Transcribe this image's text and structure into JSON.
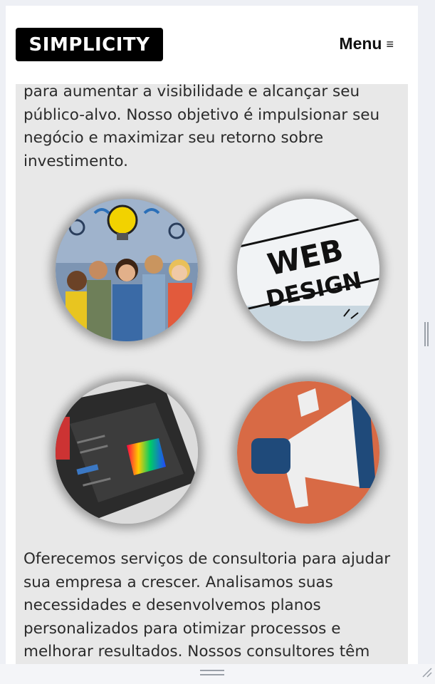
{
  "header": {
    "logo_text": "SIMPLICITY",
    "menu_label": "Menu",
    "menu_icon": "hamburger-icon"
  },
  "content": {
    "paragraph_top": "para aumentar a visibilidade e alcançar seu público-alvo. Nosso objetivo é impulsionar seu negócio e maximizar seu retorno sobre investimento.",
    "paragraph_bottom": "Oferecemos serviços de consultoria para ajudar sua empresa a crescer. Analisamos suas necessidades e desenvolvemos planos personalizados para otimizar processos e melhorar resultados. Nossos consultores têm",
    "images": [
      {
        "name": "team-people-image"
      },
      {
        "name": "web-design-image",
        "text_line1": "WEB",
        "text_line2": "DESIGN"
      },
      {
        "name": "photo-editor-image"
      },
      {
        "name": "megaphone-image"
      }
    ]
  },
  "colors": {
    "logo_bg": "#000000",
    "content_bg": "#e8e8e8",
    "text": "#2a2a2a",
    "megaphone_bg": "#d86a45",
    "megaphone_blue": "#1f4a7a"
  }
}
